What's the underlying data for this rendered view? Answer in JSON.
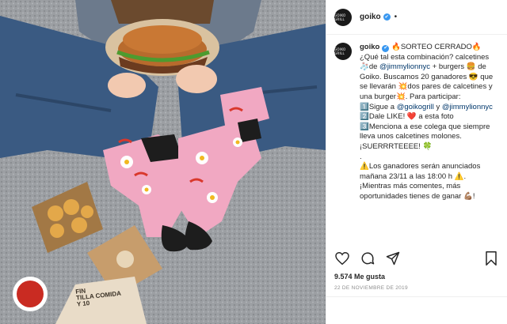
{
  "logo_text": "GOIKO GRILL",
  "header": {
    "username": "goiko",
    "verified_badge": "✔",
    "more": "•"
  },
  "caption": {
    "username": "goiko",
    "verified_badge": "✔",
    "parts": [
      {
        "text": "🔥SORTEO CERRADO🔥\n¿Qué tal esta combinación? calcetines 🧦de "
      },
      {
        "text": "@jimmylionnyc",
        "mention": true
      },
      {
        "text": " + burgers 🍔 de Goiko. Buscamos 20 ganadores 😎 que se llevarán 💥dos pares de calcetines y una burger💥. Para participar:\n1️⃣Sigue a "
      },
      {
        "text": "@goikogrill",
        "mention": true
      },
      {
        "text": " y "
      },
      {
        "text": "@jimmylionnyc",
        "mention": true
      },
      {
        "text": "\n2️⃣Dale LIKE! ❤️ a esta foto\n3️⃣Menciona a ese colega que siempre lleva unos calcetines molones. ¡SUERRRTEEEE! 🍀\n.\n⚠️Los ganadores serán anunciados mañana 23/11 a las 18:00 h ⚠️. ¡Mientras más comentes, más oportunidades tienes de ganar 💪🏽!"
      }
    ]
  },
  "likes": "9.574 Me gusta",
  "date": "22 DE NOVIEMBRE DE 2019",
  "photo_box_text": "FIN\nTILLA COMIDA\nY 10"
}
